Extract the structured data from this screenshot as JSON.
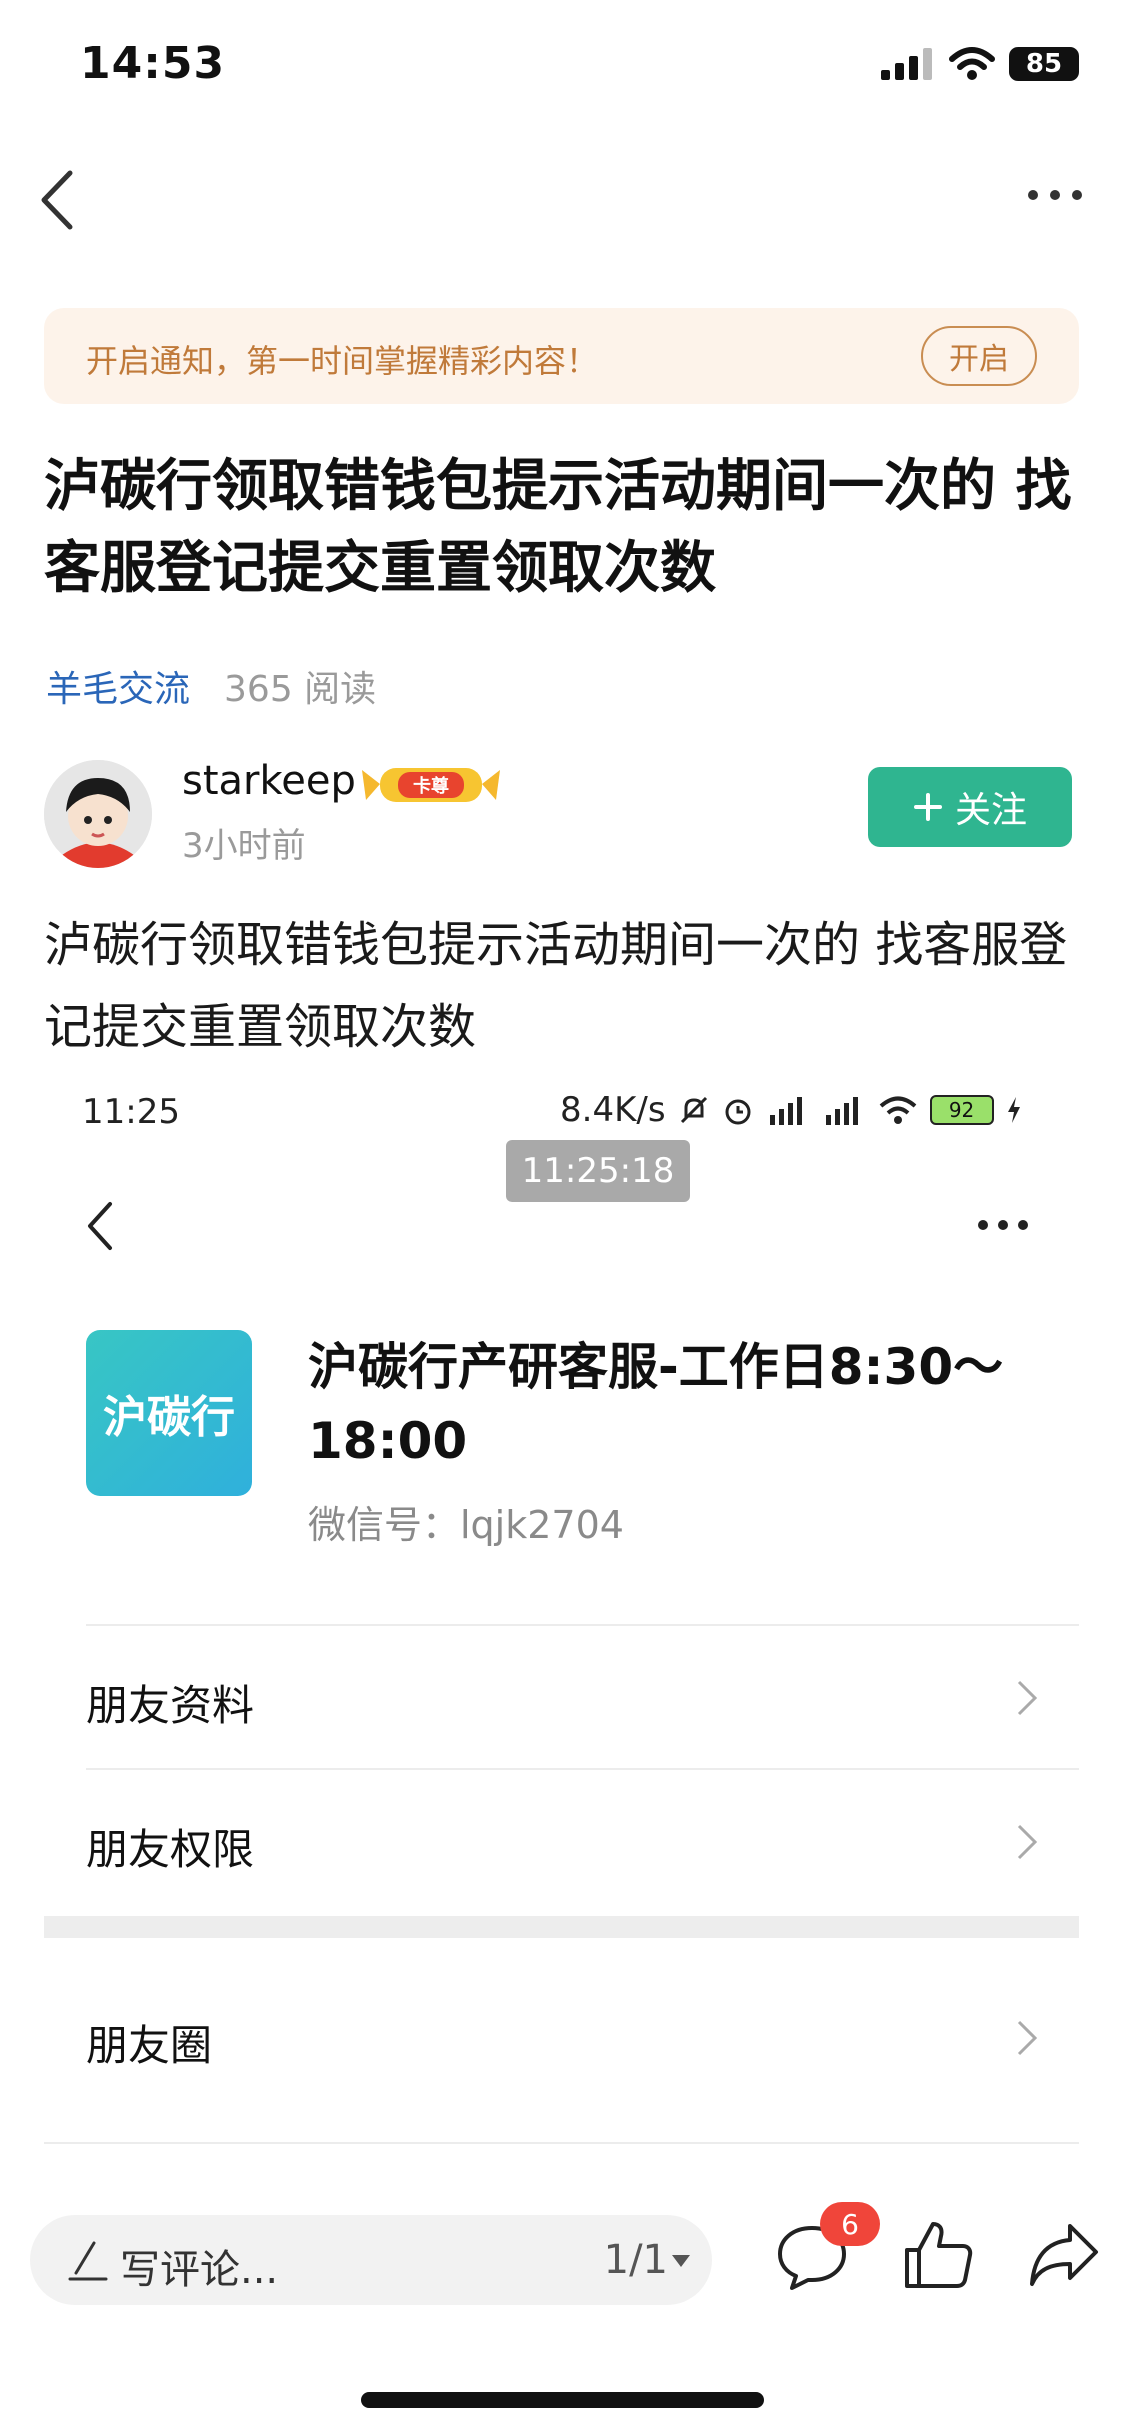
{
  "status_bar": {
    "time": "14:53",
    "battery": "85"
  },
  "notice": {
    "text": "开启通知，第一时间掌握精彩内容！",
    "button": "开启"
  },
  "article": {
    "title": "泸碳行领取错钱包提示活动期间一次的 找客服登记提交重置领取次数",
    "category": "羊毛交流",
    "reads": "365 阅读",
    "body": "泸碳行领取错钱包提示活动期间一次的 找客服登记提交重置领取次数"
  },
  "author": {
    "name": "starkeep",
    "badge": "卡尊",
    "time": "3小时前",
    "follow_label": "关注"
  },
  "screenshot": {
    "time": "11:25",
    "net_speed": "8.4K/s",
    "battery": "92",
    "timestamp_chip": "11:25:18",
    "app_icon_text": "沪碳行",
    "contact_name": "沪碳行产研客服-工作日8:30～18:00",
    "wechat_id": "微信号：lqjk2704",
    "rows": [
      "朋友资料",
      "朋友权限",
      "朋友圈"
    ]
  },
  "bottom_bar": {
    "comment_placeholder": "写评论...",
    "page": "1/1",
    "comment_count": "6"
  },
  "colors": {
    "accent_green": "#2fb590",
    "link_blue": "#2a66b8",
    "notice_bg": "#fdf3ea",
    "badge_red": "#f0453a"
  }
}
